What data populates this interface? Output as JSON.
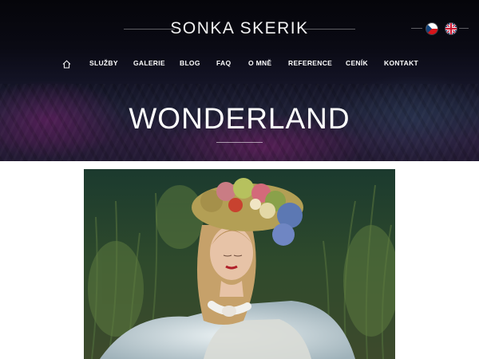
{
  "site": {
    "title": "SONKA SKERIK"
  },
  "languages": [
    {
      "code": "cz",
      "icon": "czech-flag-icon"
    },
    {
      "code": "en",
      "icon": "uk-flag-icon"
    }
  ],
  "nav": {
    "home_icon": "home-icon",
    "items": [
      {
        "label": "SLUŽBY"
      },
      {
        "label": "GALERIE"
      },
      {
        "label": "BLOG"
      },
      {
        "label": "FAQ"
      },
      {
        "label": "O MNĚ"
      },
      {
        "label": "REFERENCE"
      },
      {
        "label": "CENÍK"
      },
      {
        "label": "KONTAKT"
      }
    ]
  },
  "page": {
    "heading": "WONDERLAND"
  },
  "colors": {
    "header_dark": "#0a0a14",
    "accent_purple": "#7a1f6e",
    "text": "#ffffff"
  }
}
